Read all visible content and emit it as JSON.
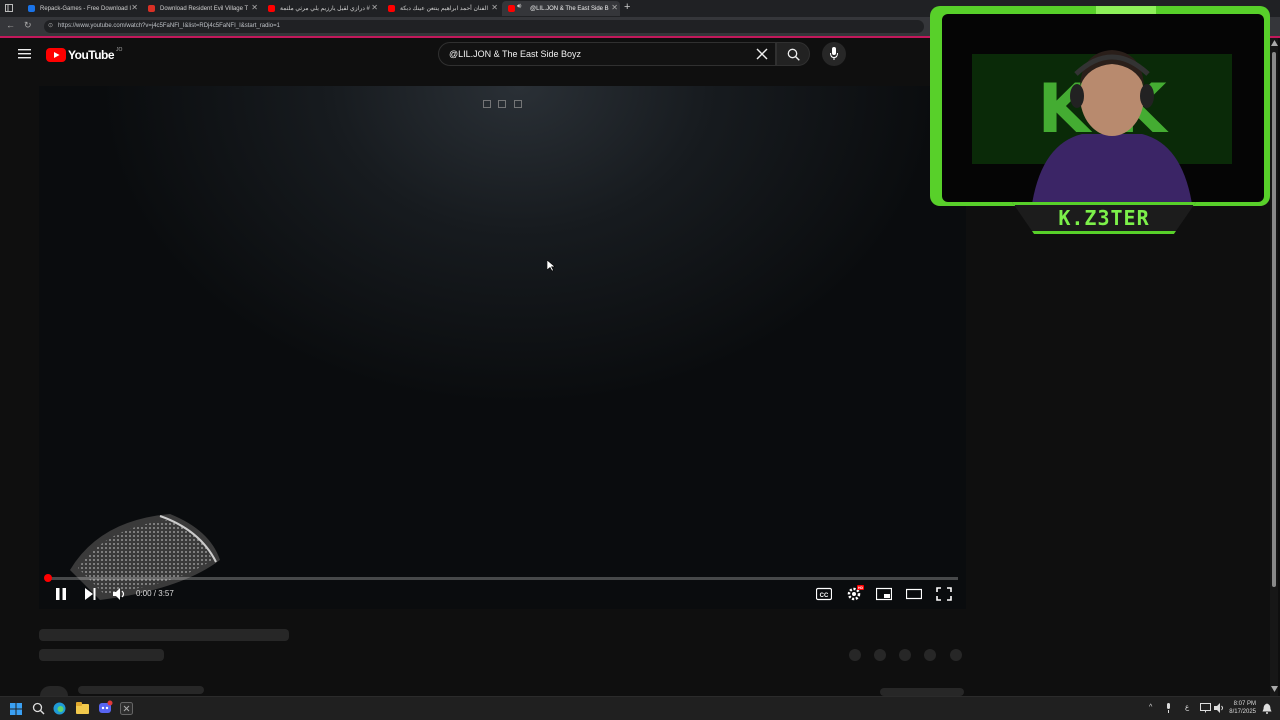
{
  "browser": {
    "tabs": [
      {
        "label": "Repack-Games - Free Download I",
        "favicon_color": "#1a73e8",
        "active": false
      },
      {
        "label": "Download Resident Evil Village T",
        "favicon_color": "#d93025",
        "active": false
      },
      {
        "label": "درازي لقيل يارزيم يلي مرثي ملثمة #",
        "favicon_color": "#ff0000",
        "active": false
      },
      {
        "label": "الفنان أحمد ابراهيم ينتعن عينك دبكة",
        "favicon_color": "#ff0000",
        "active": false
      },
      {
        "label": "@LIL.JON & The East Side B",
        "favicon_color": "#ff0000",
        "active": true
      }
    ],
    "url": "https://www.youtube.com/watch?v=j4c5FaNFI_I&list=RDj4c5FaNFI_I&start_radio=1"
  },
  "youtube": {
    "logo_text": "YouTube",
    "country_code": "JO",
    "search_value": "@LIL.JON & The East Side Boyz"
  },
  "player": {
    "time": "0:00 / 3:57",
    "progress_fraction": 0.0,
    "hd_badge": "HD"
  },
  "streamer": {
    "name": "K.Z3TER",
    "accent": "#58d02a"
  },
  "taskbar": {
    "lang": "ع",
    "time": "8:07 PM",
    "date": "8/17/2025"
  }
}
